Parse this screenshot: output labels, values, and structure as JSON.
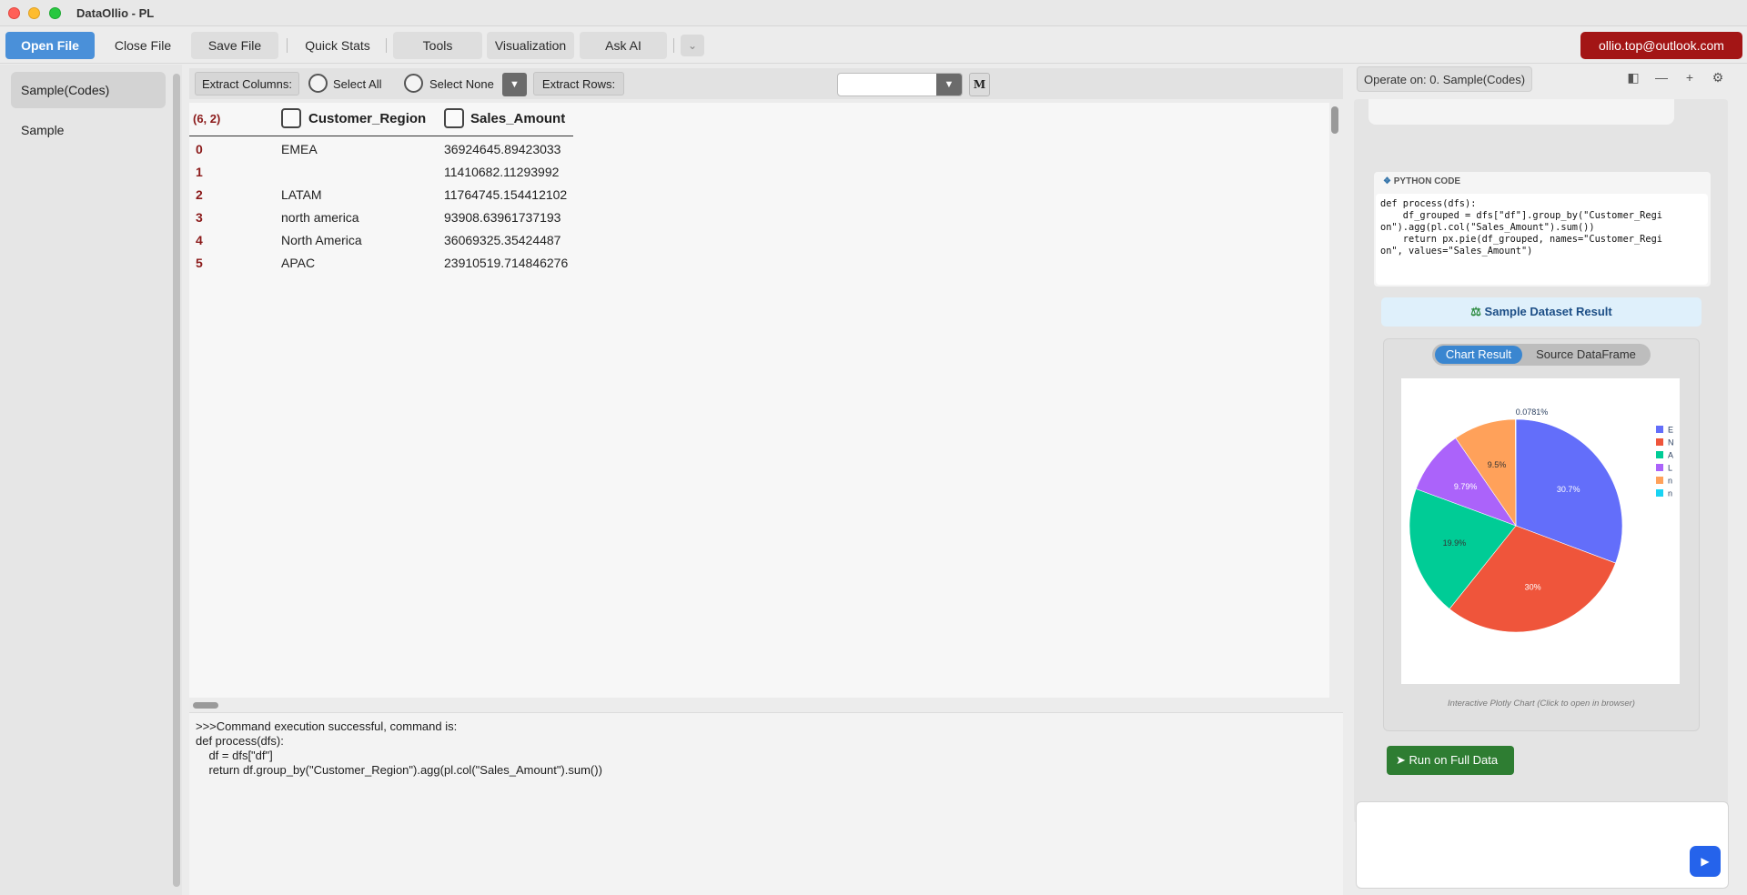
{
  "window": {
    "title": "DataOllio - PL"
  },
  "menu": {
    "open_file": "Open File",
    "close_file": "Close File",
    "save_file": "Save File",
    "quick_stats": "Quick Stats",
    "tools": "Tools",
    "visualization": "Visualization",
    "ask_ai": "Ask AI",
    "account": "ollio.top@outlook.com"
  },
  "sidebar": {
    "items": [
      {
        "label": "Sample(Codes)"
      },
      {
        "label": "Sample"
      }
    ]
  },
  "toolbar": {
    "extract_columns": "Extract Columns:",
    "select_all": "Select All",
    "select_none": "Select None",
    "extract_rows": "Extract Rows:",
    "extract_rows_value": "",
    "m_button": "M"
  },
  "table": {
    "shape": "(6, 2)",
    "columns": [
      "Customer_Region",
      "Sales_Amount"
    ],
    "rows": [
      {
        "index": "0",
        "region": "EMEA",
        "amount": "36924645.89423033"
      },
      {
        "index": "1",
        "region": "",
        "amount": "11410682.11293992"
      },
      {
        "index": "2",
        "region": "LATAM",
        "amount": "11764745.154412102"
      },
      {
        "index": "3",
        "region": "north america",
        "amount": "93908.63961737193"
      },
      {
        "index": "4",
        "region": "North America",
        "amount": "36069325.35424487"
      },
      {
        "index": "5",
        "region": "APAC",
        "amount": "23910519.714846276"
      }
    ]
  },
  "console": {
    "output": ">>>Command execution successful, command is:\ndef process(dfs):\n    df = dfs[\"df\"]\n    return df.group_by(\"Customer_Region\").agg(pl.col(\"Sales_Amount\").sum())"
  },
  "right_panel": {
    "operate_on": "Operate on: 0. Sample(Codes)",
    "code_header": "PYTHON CODE",
    "code": "def process(dfs):\n    df_grouped = dfs[\"df\"].group_by(\"Customer_Regi\non\").agg(pl.col(\"Sales_Amount\").sum())\n    return px.pie(df_grouped, names=\"Customer_Regi\non\", values=\"Sales_Amount\")",
    "sample_result": "Sample Dataset Result",
    "tab_chart": "Chart Result",
    "tab_source": "Source DataFrame",
    "caption": "Interactive Plotly Chart (Click to open in browser)",
    "run_full": "Run on Full Data",
    "input_value": ""
  },
  "colors": {
    "accent": "#4a90d9",
    "account_bg": "#a31515",
    "run_bg": "#2e7d32",
    "send_bg": "#2563eb"
  },
  "icons": {
    "send": "play-icon",
    "python": "python-icon",
    "sample": "test-tube-icon",
    "run": "rocket-icon"
  },
  "chart_data": {
    "type": "pie",
    "slices": [
      {
        "label": "E",
        "value": 30.7,
        "pct_label": "30.7%",
        "color": "#636efa"
      },
      {
        "label": "N",
        "value": 30.0,
        "pct_label": "30%",
        "color": "#ef553b"
      },
      {
        "label": "A",
        "value": 19.9,
        "pct_label": "19.9%",
        "color": "#00cc96"
      },
      {
        "label": "L",
        "value": 9.79,
        "pct_label": "9.79%",
        "color": "#ab63fa"
      },
      {
        "label": "n",
        "value": 9.5,
        "pct_label": "9.5%",
        "color": "#ffa15a"
      },
      {
        "label": "n",
        "value": 0.0781,
        "pct_label": "0.0781%",
        "color": "#19d3f3"
      }
    ],
    "legend_position": "right"
  }
}
